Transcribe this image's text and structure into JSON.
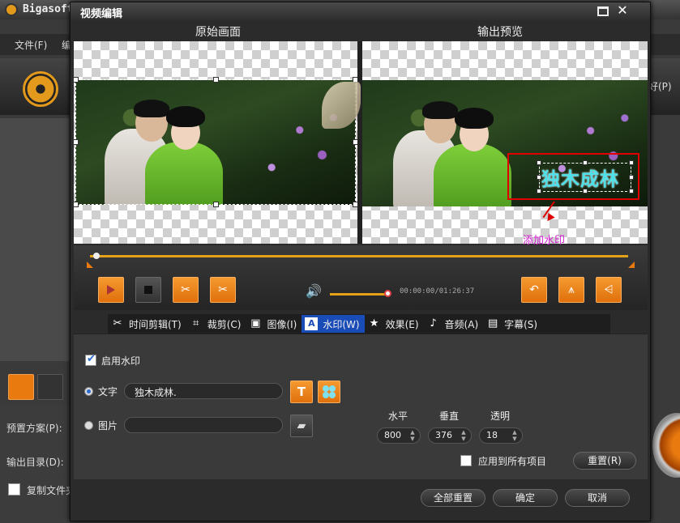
{
  "app": {
    "title": "Bigasoft",
    "menu_file": "文件(F)",
    "menu_edit": "编",
    "menu_pref": "好(P)",
    "preset_label": "预置方案(P):",
    "output_dir_label": "输出目录(D):",
    "copy_file_label": "复制文件夹"
  },
  "dialog": {
    "title": "视频编辑",
    "original_label": "原始画面",
    "preview_label": "输出预览",
    "annotation": "添加水印",
    "watermark_preview_text": "独木成林",
    "time_display": "00:00:00/01:26:37",
    "tabs": [
      {
        "label": "时间剪辑(T)",
        "icon": "scissors-icon"
      },
      {
        "label": "裁剪(C)",
        "icon": "crop-icon"
      },
      {
        "label": "图像(I)",
        "icon": "image-icon"
      },
      {
        "label": "水印(W)",
        "icon": "watermark-icon",
        "active": true
      },
      {
        "label": "效果(E)",
        "icon": "star-icon"
      },
      {
        "label": "音频(A)",
        "icon": "music-note-icon"
      },
      {
        "label": "字幕(S)",
        "icon": "subtitle-icon"
      }
    ],
    "watermark": {
      "enable_label": "启用水印",
      "enabled": true,
      "text_label": "文字",
      "text_value": "独木成林.",
      "image_label": "图片",
      "image_value": "",
      "mode": "text",
      "horizontal_label": "水平",
      "vertical_label": "垂直",
      "transparency_label": "透明",
      "horizontal": "800",
      "vertical": "376",
      "transparency": "18",
      "apply_all_label": "应用到所有项目",
      "apply_all": false,
      "reset_label": "重置(R)"
    },
    "footer": {
      "reset_all": "全部重置",
      "ok": "确定",
      "cancel": "取消"
    },
    "colors": {
      "accent": "#e87a10",
      "active_tab": "#1a4cb8",
      "watermark_text": "#4ee0e8",
      "annotation_box": "#e00000",
      "annotation_text": "#d020d0"
    }
  }
}
